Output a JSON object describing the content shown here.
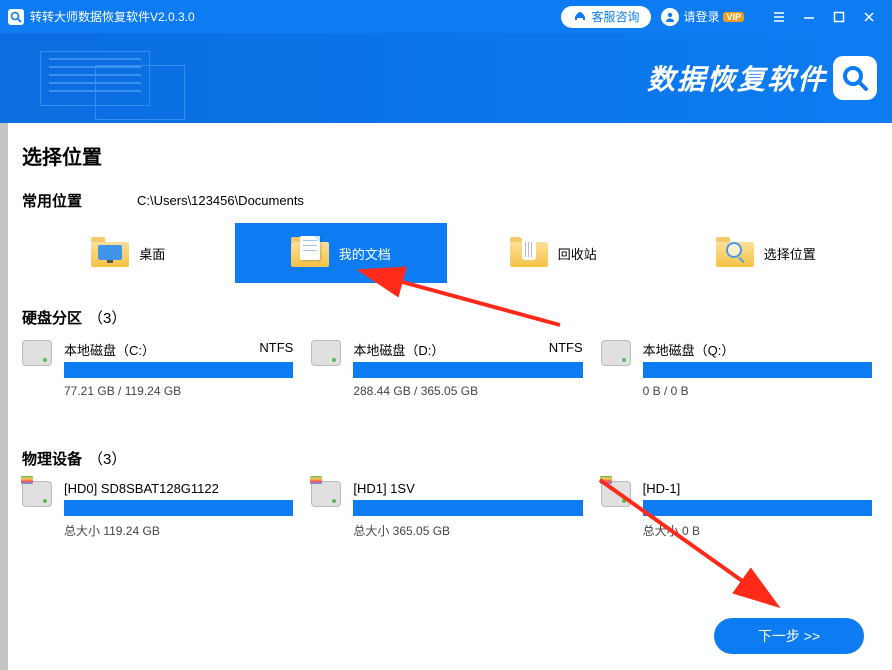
{
  "titlebar": {
    "title": "转转大师数据恢复软件V2.0.3.0",
    "cs_label": "客服咨询",
    "login_label": "请登录",
    "vip_label": "VIP"
  },
  "banner": {
    "title": "数据恢复软件"
  },
  "main": {
    "heading": "选择位置",
    "common_locations": {
      "title": "常用位置",
      "path": "C:\\Users\\123456\\Documents",
      "items": [
        {
          "label": "桌面",
          "kind": "desktop"
        },
        {
          "label": "我的文档",
          "kind": "docs",
          "selected": true
        },
        {
          "label": "回收站",
          "kind": "recycle"
        },
        {
          "label": "选择位置",
          "kind": "browse"
        }
      ]
    },
    "partitions": {
      "title": "硬盘分区",
      "count_prefix": "（",
      "count": "3",
      "count_suffix": "）",
      "items": [
        {
          "name": "本地磁盘（C:）",
          "fs": "NTFS",
          "size": "77.21 GB / 119.24 GB",
          "used_pct": 100
        },
        {
          "name": "本地磁盘（D:）",
          "fs": "NTFS",
          "size": "288.44 GB / 365.05 GB",
          "used_pct": 100
        },
        {
          "name": "本地磁盘（Q:）",
          "fs": "",
          "size": "0 B / 0 B",
          "used_pct": 100
        }
      ]
    },
    "physical": {
      "title": "物理设备",
      "count_prefix": "（",
      "count": "3",
      "count_suffix": "）",
      "items": [
        {
          "name": "[HD0] SD8SBAT128G1122",
          "size": "总大小 119.24 GB"
        },
        {
          "name": "[HD1] 1SV",
          "size": "总大小 365.05 GB"
        },
        {
          "name": "[HD-1]",
          "size": "总大小 0 B"
        }
      ]
    },
    "next_label": "下一步 >>"
  }
}
